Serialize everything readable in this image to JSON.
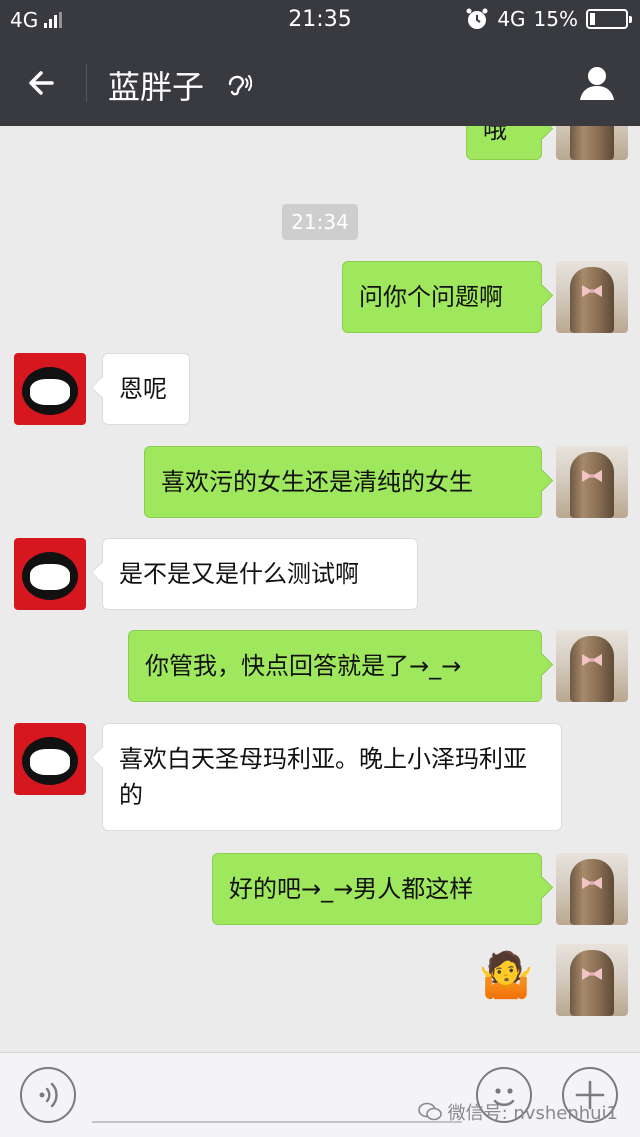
{
  "status_bar": {
    "network": "4G",
    "time": "21:35",
    "network_right": "4G",
    "battery": "15%",
    "battery_level": 0.15
  },
  "header": {
    "title": "蓝胖子",
    "icons": {
      "back": "back-arrow-icon",
      "mode": "ear-icon",
      "profile": "user-icon"
    }
  },
  "chat": {
    "messages": [
      {
        "sender": "self",
        "text": "哦"
      },
      {
        "type": "timestamp",
        "text": "21:34"
      },
      {
        "sender": "self",
        "text": "问你个问题啊"
      },
      {
        "sender": "other",
        "text": "恩呢"
      },
      {
        "sender": "self",
        "text": "喜欢污的女生还是清纯的女生"
      },
      {
        "sender": "other",
        "text": "是不是又是什么测试啊"
      },
      {
        "sender": "self",
        "text": "你管我，快点回答就是了→_→"
      },
      {
        "sender": "other",
        "text": "喜欢白天圣母玛利亚。晚上小泽玛利亚的"
      },
      {
        "sender": "self",
        "text": "好的吧→_→男人都这样"
      },
      {
        "sender": "self",
        "type": "emoji",
        "text": "🤷"
      }
    ]
  },
  "input_bar": {
    "icons": {
      "voice": "voice-icon",
      "emoji": "smiley-icon",
      "plus": "plus-icon"
    },
    "watermark": "微信号: nvshenhui1"
  },
  "colors": {
    "self_bubble": "#9fe75c",
    "other_bubble": "#ffffff",
    "header": "#393a3f",
    "background": "#ebebeb"
  }
}
